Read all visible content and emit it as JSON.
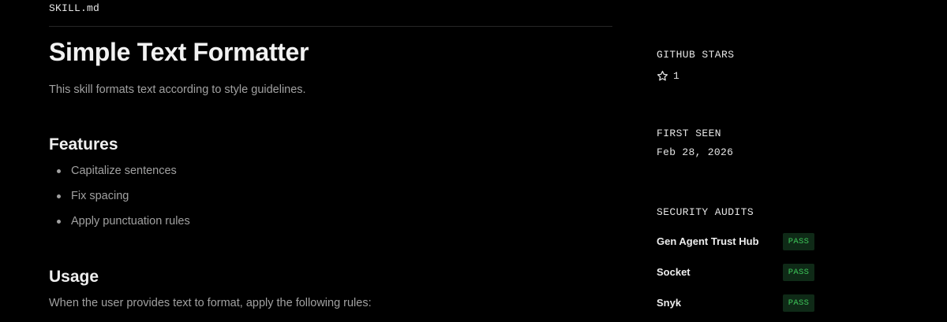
{
  "file": {
    "name": "SKILL.md"
  },
  "document": {
    "title": "Simple Text Formatter",
    "description": "This skill formats text according to style guidelines.",
    "features": {
      "heading": "Features",
      "items": [
        "Capitalize sentences",
        "Fix spacing",
        "Apply punctuation rules"
      ]
    },
    "usage": {
      "heading": "Usage",
      "text": "When the user provides text to format, apply the following rules:"
    }
  },
  "sidebar": {
    "github_stars": {
      "label": "GITHUB STARS",
      "icon": "star-icon",
      "count": "1"
    },
    "first_seen": {
      "label": "FIRST SEEN",
      "date": "Feb 28, 2026"
    },
    "security_audits": {
      "label": "SECURITY AUDITS",
      "items": [
        {
          "name": "Gen Agent Trust Hub",
          "status": "PASS"
        },
        {
          "name": "Socket",
          "status": "PASS"
        },
        {
          "name": "Snyk",
          "status": "PASS"
        }
      ]
    }
  },
  "colors": {
    "background": "#000000",
    "pass_text": "#3ec95a",
    "pass_background": "#0f2a17"
  }
}
